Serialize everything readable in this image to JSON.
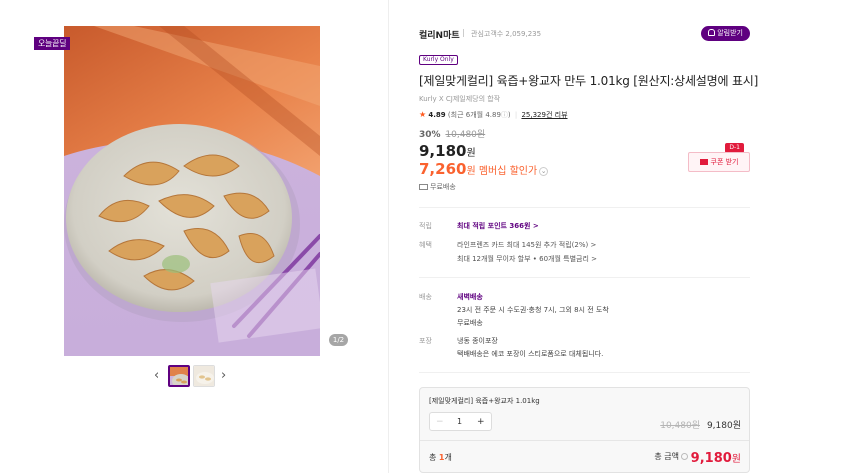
{
  "gallery": {
    "badge": "오늘끝딜",
    "page_indicator": "1/2",
    "prev_icon": "chevron-left-icon",
    "next_icon": "chevron-right-icon"
  },
  "seller": {
    "brand": "컬리N마트",
    "followers": "관심고객수 2,059,235",
    "alarm_label": "알림받기"
  },
  "product": {
    "tag": "Kurly Only",
    "title": "[제일맞게컬리] 육즙+왕교자 만두 1.01kg [원산지:상세설명에 표시]",
    "subtitle": "Kurly X CJ제일제당의 합작",
    "rating": "4.89",
    "rating_detail": "(최근 6개월 4.89",
    "rating_close": ")",
    "reviews": "25,329건 리뷰",
    "discount_rate": "30%",
    "original_price": "10,480원",
    "price": "9,180",
    "price_unit": "원",
    "member_price": "7,260",
    "member_label": "원 멤버십 할인가",
    "shipping": "무료배송"
  },
  "coupon": {
    "dday": "D-1",
    "label": "쿠폰 받기"
  },
  "info": [
    {
      "label": "적립",
      "lines": [
        "최대 적립 포인트 366원 >"
      ]
    },
    {
      "label": "혜택",
      "lines": [
        "라인프렌즈 카드 최대 145원 추가 적립(2%) >",
        "최대 12개월 무이자 할부 • 60개월 특별금리 >"
      ]
    },
    {
      "label": "배송",
      "lines": [
        "새벽배송",
        "23시 전 주문 시 수도권·충청 7시, 그외 8시 전 도착",
        "무료배송"
      ]
    },
    {
      "label": "포장",
      "lines": [
        "냉동 종이포장",
        "택배배송은 에코 포장이 스티로폼으로 대체됩니다."
      ]
    }
  ],
  "option": {
    "name": "[제일맞게컬리] 육즙+왕교자 1.01kg",
    "minus": "−",
    "quantity": "1",
    "plus": "+",
    "original_price": "10,480원",
    "price": "9,180원"
  },
  "total": {
    "count_prefix": "총 ",
    "count": "1",
    "count_suffix": "개",
    "label": "총 금액",
    "price": "9,180",
    "unit": "원"
  },
  "colors": {
    "brand_purple": "#5f0080",
    "member_orange": "#fa622f",
    "coupon_red": "#e11b3c"
  }
}
